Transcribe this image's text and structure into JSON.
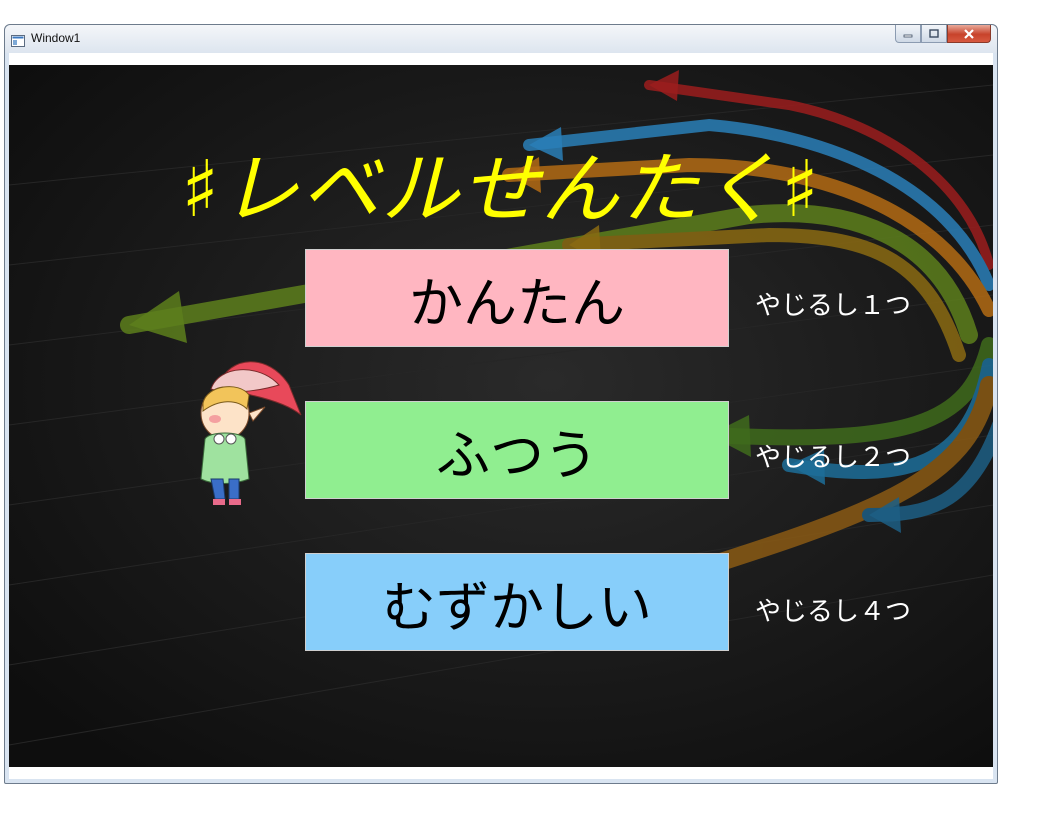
{
  "window": {
    "title": "Window1"
  },
  "page": {
    "title": "♯レベルせんたく♯"
  },
  "levels": [
    {
      "label": "かんたん",
      "hint": "やじるし１つ",
      "color": "#ffb6c1"
    },
    {
      "label": "ふつう",
      "hint": "やじるし２つ",
      "color": "#90ee90"
    },
    {
      "label": "むずかしい",
      "hint": "やじるし４つ",
      "color": "#87cefa"
    }
  ],
  "colors": {
    "title": "#ffff00",
    "background": "#141414",
    "hint": "#ffffff"
  },
  "icons": {
    "window": "app-window-icon",
    "minimize": "minimize-icon",
    "maximize": "maximize-icon",
    "close": "close-icon"
  }
}
